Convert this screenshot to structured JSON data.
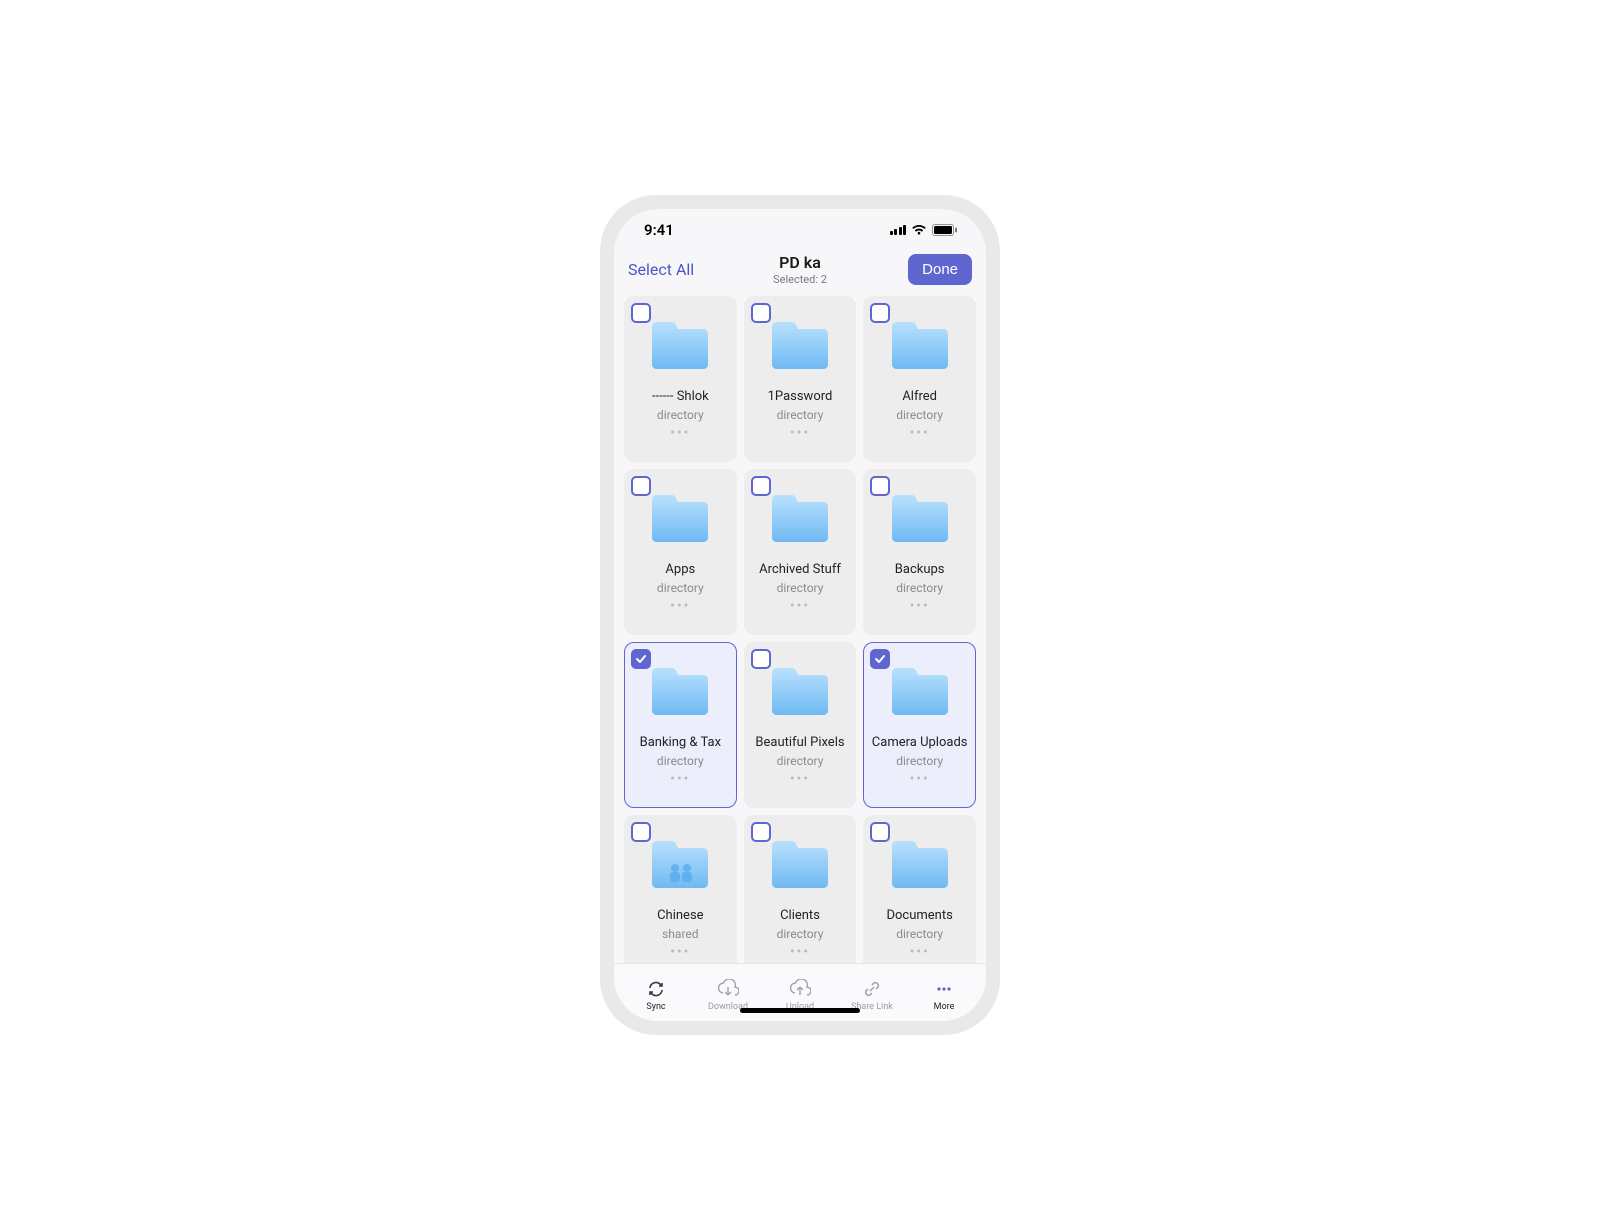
{
  "status": {
    "time": "9:41"
  },
  "nav": {
    "select_all": "Select All",
    "title": "PD ka",
    "subtitle": "Selected: 2",
    "done": "Done"
  },
  "folders": [
    {
      "name": "------ Shlok",
      "type": "directory",
      "selected": false,
      "shared": false
    },
    {
      "name": "1Password",
      "type": "directory",
      "selected": false,
      "shared": false
    },
    {
      "name": "Alfred",
      "type": "directory",
      "selected": false,
      "shared": false
    },
    {
      "name": "Apps",
      "type": "directory",
      "selected": false,
      "shared": false
    },
    {
      "name": "Archived Stuff",
      "type": "directory",
      "selected": false,
      "shared": false
    },
    {
      "name": "Backups",
      "type": "directory",
      "selected": false,
      "shared": false
    },
    {
      "name": "Banking & Tax",
      "type": "directory",
      "selected": true,
      "shared": false
    },
    {
      "name": "Beautiful Pixels",
      "type": "directory",
      "selected": false,
      "shared": false
    },
    {
      "name": "Camera Uploads",
      "type": "directory",
      "selected": true,
      "shared": false
    },
    {
      "name": "Chinese",
      "type": "shared",
      "selected": false,
      "shared": true
    },
    {
      "name": "Clients",
      "type": "directory",
      "selected": false,
      "shared": false
    },
    {
      "name": "Documents",
      "type": "directory",
      "selected": false,
      "shared": false
    }
  ],
  "toolbar": [
    {
      "label": "Sync",
      "icon": "sync",
      "active": true
    },
    {
      "label": "Download",
      "icon": "download",
      "active": false
    },
    {
      "label": "Upload",
      "icon": "upload",
      "active": false
    },
    {
      "label": "Share Link",
      "icon": "link",
      "active": false
    },
    {
      "label": "More",
      "icon": "more",
      "active": true
    }
  ],
  "colors": {
    "accent": "#5f66d0",
    "folder_light": "#a9d8fb",
    "folder_med": "#7ec3f7",
    "folder_dark": "#5aaef0"
  }
}
